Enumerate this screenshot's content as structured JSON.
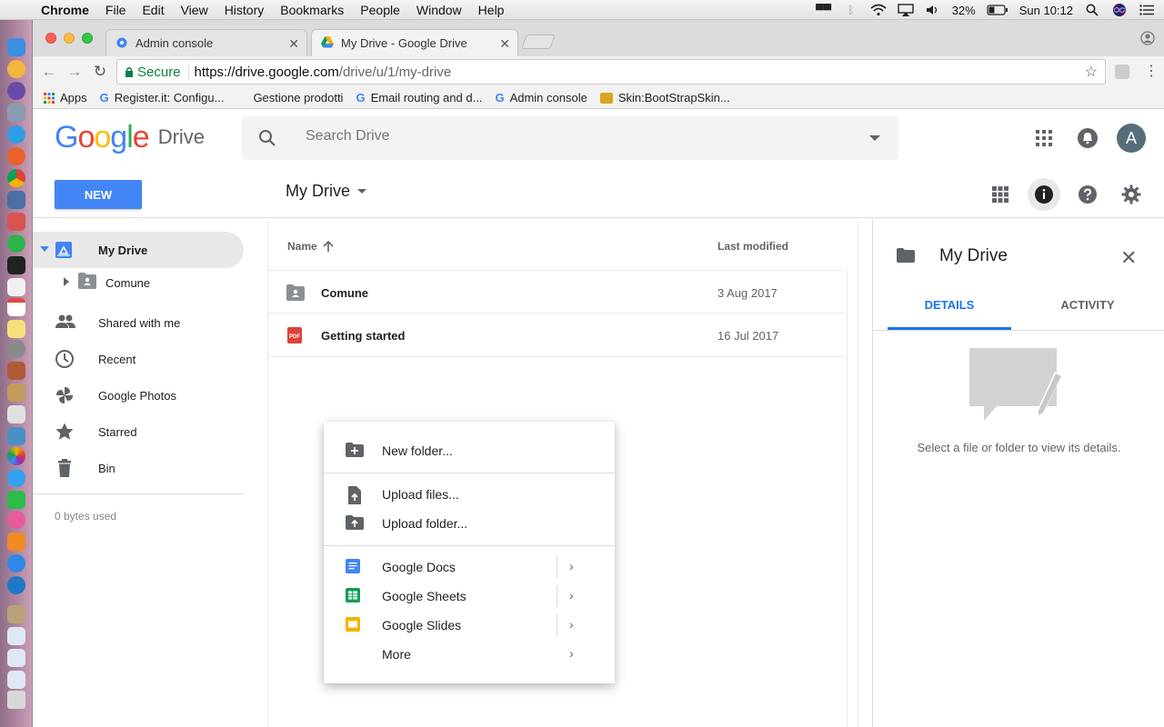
{
  "menubar": {
    "app_name": "Chrome",
    "items": [
      "File",
      "Edit",
      "View",
      "History",
      "Bookmarks",
      "People",
      "Window",
      "Help"
    ],
    "battery": "32%",
    "clock": "Sun 10:12"
  },
  "browser": {
    "tabs": [
      {
        "title": "Admin console"
      },
      {
        "title": "My Drive - Google Drive"
      }
    ],
    "secure_label": "Secure",
    "url_host": "https://drive.google.com",
    "url_path": "/drive/u/1/my-drive",
    "bookmarks": [
      {
        "label": "Apps"
      },
      {
        "label": "Register.it: Configu..."
      },
      {
        "label": "Gestione prodotti"
      },
      {
        "label": "Email routing and d..."
      },
      {
        "label": "Admin console"
      },
      {
        "label": "Skin:BootStrapSkin..."
      }
    ]
  },
  "drive": {
    "logo_text": "Google",
    "product": "Drive",
    "search_placeholder": "Search Drive",
    "avatar_initial": "A",
    "new_button": "NEW",
    "breadcrumb": "My Drive",
    "sidebar": [
      {
        "label": "My Drive",
        "icon": "my-drive-icon"
      },
      {
        "label": "Comune",
        "icon": "shared-folder-icon"
      },
      {
        "label": "Shared with me",
        "icon": "people-icon"
      },
      {
        "label": "Recent",
        "icon": "clock-icon"
      },
      {
        "label": "Google Photos",
        "icon": "pinwheel-icon"
      },
      {
        "label": "Starred",
        "icon": "star-icon"
      },
      {
        "label": "Bin",
        "icon": "trash-icon"
      }
    ],
    "storage": "0 bytes used",
    "columns": {
      "name": "Name",
      "modified": "Last modified"
    },
    "files": [
      {
        "name": "Comune",
        "modified": "3 Aug 2017",
        "icon": "shared-folder-icon"
      },
      {
        "name": "Getting started",
        "modified": "16 Jul 2017",
        "icon": "pdf-icon"
      }
    ],
    "context_menu": [
      {
        "label": "New folder...",
        "icon": "new-folder-icon"
      },
      {
        "label": "Upload files...",
        "icon": "upload-file-icon"
      },
      {
        "label": "Upload folder...",
        "icon": "upload-folder-icon"
      },
      {
        "label": "Google Docs",
        "icon": "docs-icon"
      },
      {
        "label": "Google Sheets",
        "icon": "sheets-icon"
      },
      {
        "label": "Google Slides",
        "icon": "slides-icon"
      },
      {
        "label": "More",
        "icon": ""
      }
    ],
    "details": {
      "title": "My Drive",
      "tabs": [
        "DETAILS",
        "ACTIVITY"
      ],
      "message": "Select a file or folder to view its details."
    }
  },
  "colors": {
    "accent": "#4285f4",
    "active_tab": "#1a73e8",
    "docs": "#4285f4",
    "sheets": "#0f9d58",
    "slides": "#f4b400",
    "pdf": "#db4437"
  }
}
